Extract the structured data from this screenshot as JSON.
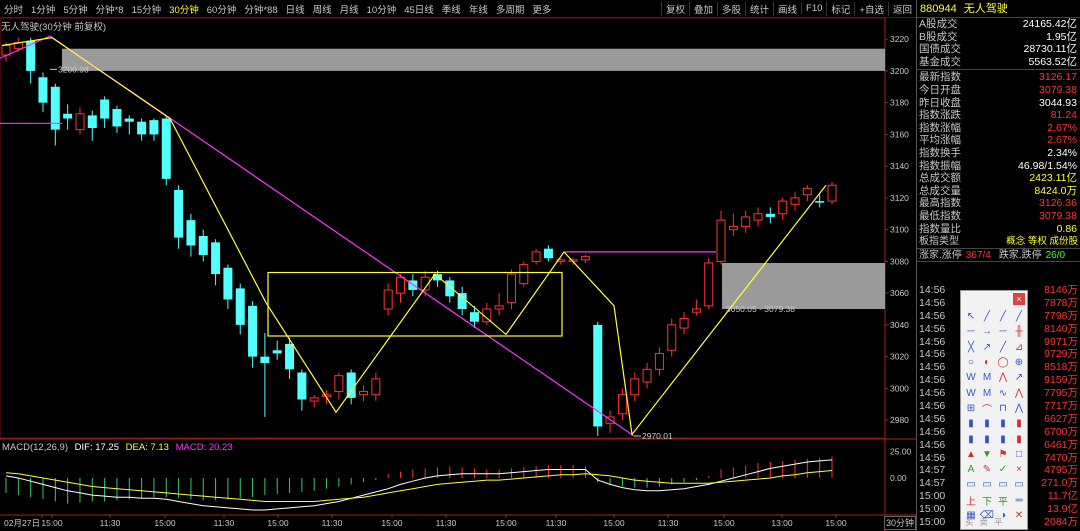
{
  "toolbar": {
    "periods": [
      "分时",
      "1分钟",
      "5分钟",
      "分钟*8",
      "15分钟",
      "30分钟",
      "60分钟",
      "分钟*88",
      "日线",
      "周线",
      "月线",
      "10分钟",
      "45日线",
      "季线",
      "年线",
      "多周期",
      "更多"
    ],
    "active_period": "30分钟",
    "right_buttons": [
      "复权",
      "叠加",
      "多股",
      "统计",
      "画线",
      "F10",
      "标记",
      "+自选",
      "返回"
    ]
  },
  "chart": {
    "title": "无人驾驶(30分钟 前复权)",
    "y_ticks": [
      "3220",
      "3200",
      "3180",
      "3160",
      "3140",
      "3120",
      "3100",
      "3080",
      "3060",
      "3040",
      "3020",
      "3000",
      "2980"
    ],
    "x_ticks": [
      "02月27日",
      "15:00",
      "11:30",
      "15:00",
      "11:30",
      "15:00",
      "11:30",
      "15:00",
      "11:30",
      "15:00",
      "11:30",
      "15:00",
      "11:30",
      "15:00",
      "13:00",
      "15:00"
    ],
    "annotations": {
      "high_label": "3200.98",
      "low_label": "2970.01",
      "range_label": "3050.05 - 3079.38"
    },
    "macd_title": "MACD(12,26,9)",
    "macd_dif": "DIF: 17.25",
    "macd_dea": "DEA: 7.13",
    "macd_val": "MACD: 20.23",
    "macd_ticks": [
      "25.00",
      "0.00"
    ],
    "period_badge": "30分钟",
    "colors": {
      "up": "#ff3232",
      "down": "#54ffff",
      "trend": "#ff33ff",
      "wave": "#ffff33",
      "box": "#ffff33"
    }
  },
  "chart_data": {
    "type": "candlestick",
    "title": "无人驾驶(30分钟 前复权)",
    "ylim": [
      2970,
      3222
    ],
    "series": [
      {
        "name": "DIF",
        "color": "#ffffff"
      },
      {
        "name": "DEA",
        "color": "#ffff33"
      },
      {
        "name": "MACD",
        "color": "#ff3232"
      }
    ],
    "candles": [
      [
        3210,
        3216,
        3206,
        3218
      ],
      [
        3214,
        3218,
        3212,
        3221
      ],
      [
        3219,
        3200,
        3192,
        3221
      ],
      [
        3196,
        3180,
        3174,
        3199
      ],
      [
        3190,
        3163,
        3153,
        3192
      ],
      [
        3173,
        3170,
        3163,
        3179
      ],
      [
        3163,
        3173,
        3160,
        3177
      ],
      [
        3172,
        3164,
        3156,
        3175
      ],
      [
        3182,
        3170,
        3164,
        3184
      ],
      [
        3176,
        3165,
        3161,
        3178
      ],
      [
        3170,
        3168,
        3160,
        3172
      ],
      [
        3168,
        3160,
        3156,
        3170
      ],
      [
        3169,
        3160,
        3156,
        3170
      ],
      [
        3170,
        3132,
        3128,
        3172
      ],
      [
        3125,
        3095,
        3088,
        3128
      ],
      [
        3106,
        3090,
        3083,
        3110
      ],
      [
        3096,
        3084,
        3080,
        3100
      ],
      [
        3092,
        3072,
        3065,
        3094
      ],
      [
        3076,
        3056,
        3050,
        3078
      ],
      [
        3063,
        3040,
        3034,
        3066
      ],
      [
        3052,
        3020,
        3013,
        3055
      ],
      [
        3020,
        3016,
        2982,
        3035
      ],
      [
        3024,
        3022,
        3018,
        3030
      ],
      [
        3028,
        3012,
        3006,
        3032
      ],
      [
        3010,
        2993,
        2986,
        3012
      ],
      [
        2992,
        2994,
        2988,
        2996
      ],
      [
        2995,
        2996,
        2990,
        2999
      ],
      [
        2998,
        3008,
        2993,
        3010
      ],
      [
        3010,
        2994,
        2990,
        3012
      ],
      [
        2996,
        2998,
        2992,
        3002
      ],
      [
        2996,
        3006,
        2992,
        3010
      ],
      [
        3050,
        3062,
        3046,
        3066
      ],
      [
        3060,
        3070,
        3054,
        3072
      ],
      [
        3068,
        3062,
        3058,
        3072
      ],
      [
        3062,
        3070,
        3058,
        3074
      ],
      [
        3072,
        3068,
        3064,
        3074
      ],
      [
        3068,
        3058,
        3054,
        3070
      ],
      [
        3060,
        3050,
        3046,
        3064
      ],
      [
        3048,
        3042,
        3038,
        3052
      ],
      [
        3042,
        3050,
        3040,
        3054
      ],
      [
        3050,
        3052,
        3046,
        3060
      ],
      [
        3054,
        3072,
        3050,
        3075
      ],
      [
        3066,
        3078,
        3064,
        3080
      ],
      [
        3080,
        3086,
        3078,
        3088
      ],
      [
        3088,
        3082,
        3080,
        3090
      ],
      [
        3080,
        3081,
        3078,
        3082
      ],
      [
        3080,
        3081,
        3078,
        3082
      ],
      [
        3081,
        3083,
        3079,
        3084
      ],
      [
        3040,
        2976,
        2970,
        3042
      ],
      [
        2978,
        2982,
        2972,
        2986
      ],
      [
        2984,
        2996,
        2980,
        3000
      ],
      [
        2996,
        3006,
        2992,
        3010
      ],
      [
        3004,
        3012,
        3000,
        3016
      ],
      [
        3012,
        3022,
        3008,
        3026
      ],
      [
        3024,
        3040,
        3020,
        3044
      ],
      [
        3038,
        3044,
        3034,
        3048
      ],
      [
        3048,
        3050,
        3046,
        3056
      ],
      [
        3052,
        3079,
        3050,
        3082
      ],
      [
        3080,
        3106,
        3078,
        3112
      ],
      [
        3100,
        3102,
        3096,
        3110
      ],
      [
        3102,
        3108,
        3098,
        3112
      ],
      [
        3106,
        3110,
        3102,
        3114
      ],
      [
        3110,
        3108,
        3104,
        3114
      ],
      [
        3110,
        3118,
        3106,
        3120
      ],
      [
        3116,
        3120,
        3112,
        3124
      ],
      [
        3122,
        3126,
        3118,
        3128
      ],
      [
        3118,
        3117,
        3114,
        3122
      ],
      [
        3118,
        3128,
        3116,
        3130
      ]
    ],
    "macd_hist": [
      -14,
      -16,
      -18,
      -20,
      -22,
      -24,
      -23,
      -22,
      -22,
      -21,
      -20,
      -19,
      -18,
      -18,
      -19,
      -20,
      -21,
      -21,
      -20,
      -19,
      -18,
      -16,
      -15,
      -14,
      -13,
      -12,
      -10,
      -8,
      -6,
      -4,
      -2,
      4,
      6,
      8,
      9,
      10,
      11,
      10,
      9,
      8,
      8,
      9,
      10,
      11,
      12,
      12,
      12,
      11,
      -4,
      -6,
      -8,
      -9,
      -9,
      -8,
      -6,
      -4,
      -2,
      2,
      8,
      10,
      12,
      14,
      15,
      16,
      17,
      18,
      19,
      20
    ],
    "macd_dif": [
      2,
      0,
      -3,
      -6,
      -9,
      -12,
      -14,
      -16,
      -17,
      -18,
      -18,
      -19,
      -19,
      -20,
      -22,
      -24,
      -26,
      -27,
      -28,
      -29,
      -30,
      -30,
      -29,
      -28,
      -27,
      -26,
      -24,
      -22,
      -19,
      -16,
      -13,
      -10,
      -6,
      -3,
      0,
      2,
      3,
      4,
      4,
      4,
      4,
      5,
      6,
      7,
      8,
      8,
      8,
      8,
      -2,
      -6,
      -9,
      -11,
      -12,
      -12,
      -11,
      -10,
      -8,
      -6,
      -3,
      0,
      3,
      6,
      9,
      11,
      13,
      15,
      16,
      17
    ],
    "macd_dea": [
      5,
      4,
      2,
      0,
      -2,
      -4,
      -6,
      -8,
      -9,
      -10,
      -11,
      -12,
      -13,
      -14,
      -15,
      -16,
      -17,
      -18,
      -19,
      -20,
      -21,
      -22,
      -22,
      -22,
      -22,
      -22,
      -21,
      -20,
      -19,
      -18,
      -16,
      -14,
      -12,
      -10,
      -8,
      -6,
      -5,
      -4,
      -3,
      -2,
      -2,
      -1,
      0,
      1,
      2,
      3,
      3,
      4,
      3,
      2,
      0,
      -2,
      -3,
      -4,
      -5,
      -5,
      -5,
      -5,
      -4,
      -3,
      -2,
      -1,
      0,
      2,
      3,
      5,
      6,
      7
    ]
  },
  "panel": {
    "code": "880944",
    "name": "无人驾驶",
    "rows": [
      {
        "k": "A股成交",
        "v": "24165.42亿",
        "c": "wht"
      },
      {
        "k": "B股成交",
        "v": "1.95亿",
        "c": "wht"
      },
      {
        "k": "国债成交",
        "v": "28730.11亿",
        "c": "wht"
      },
      {
        "k": "基金成交",
        "v": "5563.52亿",
        "c": "wht"
      }
    ],
    "rows2": [
      {
        "k": "最新指数",
        "v": "3126.17",
        "c": "red"
      },
      {
        "k": "今日开盘",
        "v": "3079.38",
        "c": "red"
      },
      {
        "k": "昨日收盘",
        "v": "3044.93",
        "c": "wht"
      },
      {
        "k": "指数涨跌",
        "v": "81.24",
        "c": "red"
      },
      {
        "k": "指数涨幅",
        "v": "2.67%",
        "c": "red"
      },
      {
        "k": "平均涨幅",
        "v": "2.67%",
        "c": "red"
      },
      {
        "k": "指数换手",
        "v": "2.34%",
        "c": "wht"
      },
      {
        "k": "指数振幅",
        "v": "46.98/1.54%",
        "c": "wht"
      },
      {
        "k": "总成交额",
        "v": "2423.11亿",
        "c": "yel"
      },
      {
        "k": "总成交量",
        "v": "8424.0万",
        "c": "yel"
      },
      {
        "k": "最高指数",
        "v": "3126.36",
        "c": "red"
      },
      {
        "k": "最低指数",
        "v": "3079.38",
        "c": "red"
      },
      {
        "k": "指数量比",
        "v": "0.86",
        "c": "yel"
      }
    ],
    "type_label": "板指类型",
    "type_tags": "概念 等权 成份股",
    "limit_up": "涨家.涨停",
    "limit_up_val": "367/4",
    "limit_down": "跌家.跌停",
    "limit_down_val": "26/0",
    "ticks": [
      {
        "t": "14:56",
        "v": "8146万",
        "c": "r"
      },
      {
        "t": "14:56",
        "v": "7878万",
        "c": "r"
      },
      {
        "t": "14:56",
        "v": "7798万",
        "c": "r"
      },
      {
        "t": "14:56",
        "v": "8140万",
        "c": "r"
      },
      {
        "t": "14:56",
        "v": "9971万",
        "c": "r"
      },
      {
        "t": "14:56",
        "v": "9729万",
        "c": "r"
      },
      {
        "t": "14:56",
        "v": "8518万",
        "c": "r"
      },
      {
        "t": "14:56",
        "v": "9159万",
        "c": "r"
      },
      {
        "t": "14:56",
        "v": "7795万",
        "c": "r"
      },
      {
        "t": "14:56",
        "v": "7717万",
        "c": "r"
      },
      {
        "t": "14:56",
        "v": "6627万",
        "c": "r"
      },
      {
        "t": "14:56",
        "v": "6700万",
        "c": "r"
      },
      {
        "t": "14:56",
        "v": "6461万",
        "c": "r"
      },
      {
        "t": "14:56",
        "v": "7470万",
        "c": "r"
      },
      {
        "t": "14:57",
        "v": "4795万",
        "c": "r"
      },
      {
        "t": "14:57",
        "v": "271.0万",
        "c": "r"
      },
      {
        "t": "15:00",
        "v": "11.7亿",
        "c": "r"
      },
      {
        "t": "15:00",
        "v": "13.9亿",
        "c": "r"
      },
      {
        "t": "15:00",
        "v": "2084万",
        "c": "r"
      }
    ]
  },
  "tools": {
    "footer": [
      "买",
      "卖",
      "平"
    ],
    "icons": [
      "cursor-icon",
      "line-icon",
      "ray-icon",
      "line2-icon",
      "segment-icon",
      "arrow-line-icon",
      "hline-icon",
      "channel-icon",
      "parallel-icon",
      "extend-icon",
      "fib-line-icon",
      "fan-icon",
      "circle-icon",
      "arc-icon",
      "ellipse-icon",
      "gann-icon",
      "wave-w-icon",
      "wave-m-icon",
      "zigzag-icon",
      "wave3-icon",
      "wave-w2-icon",
      "wave-m2-icon",
      "wave-icon",
      "peak-icon",
      "fib-ext-icon",
      "arch-icon",
      "bracket-icon",
      "zigzag2-icon",
      "bars-icon",
      "bars2-icon",
      "bars3-icon",
      "bars4-icon",
      "bars5-icon",
      "bars6-icon",
      "bars7-icon",
      "bars8-icon",
      "up-arrow-icon",
      "down-arrow-icon",
      "flag-icon",
      "square-icon",
      "text-icon",
      "pen-icon",
      "mark-icon",
      "cross-icon",
      "rect-icon",
      "rect2-icon",
      "rect3-icon",
      "rect4-icon",
      "up-label-icon",
      "down-label-icon",
      "flat-label-icon",
      "hline2-icon",
      "table-icon",
      "eraser-icon",
      "hide-icon",
      "delete-icon"
    ]
  }
}
